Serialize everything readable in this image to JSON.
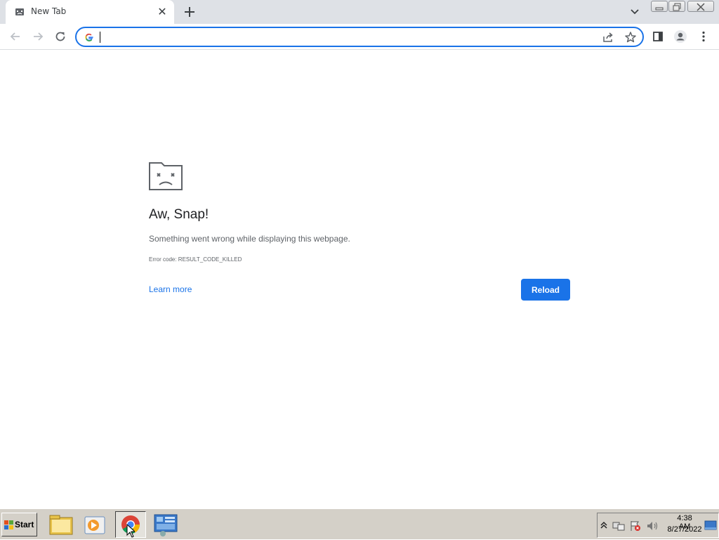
{
  "tab": {
    "title": "New Tab",
    "close_glyph": "✕"
  },
  "omnibox": {
    "value": "",
    "placeholder": ""
  },
  "error_page": {
    "title": "Aw, Snap!",
    "message": "Something went wrong while displaying this webpage.",
    "error_code": "Error code: RESULT_CODE_KILLED",
    "learn_more": "Learn more",
    "reload": "Reload"
  },
  "taskbar": {
    "start_label": "Start",
    "clock_time": "4:38 AM",
    "clock_date": "8/27/2022"
  },
  "colors": {
    "accent": "#1a73e8",
    "tabstrip": "#dee1e6",
    "taskbar": "#d4d0c8"
  }
}
